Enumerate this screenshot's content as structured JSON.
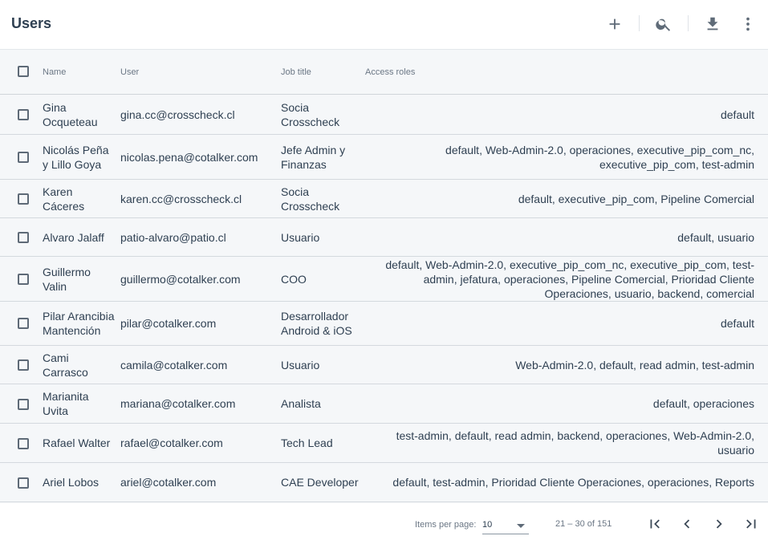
{
  "header": {
    "title": "Users",
    "actions": [
      {
        "icon": "add-icon"
      },
      {
        "icon": "search-icon"
      },
      {
        "icon": "download-icon"
      },
      {
        "icon": "more-vert-icon"
      }
    ]
  },
  "table": {
    "columns": [
      "Name",
      "User",
      "Job title",
      "Access roles"
    ],
    "rows": [
      {
        "name": "Gina Ocqueteau",
        "user": "gina.cc@crosscheck.cl",
        "job": "Socia Crosscheck",
        "roles": "default"
      },
      {
        "name": "Nicolás Peña y Lillo Goya",
        "user": "nicolas.pena@cotalker.com",
        "job": "Jefe Admin y Finanzas",
        "roles": "default, Web-Admin-2.0, operaciones, executive_pip_com_nc, executive_pip_com, test-admin"
      },
      {
        "name": "Karen Cáceres",
        "user": "karen.cc@crosscheck.cl",
        "job": "Socia Crosscheck",
        "roles": "default, executive_pip_com, Pipeline Comercial"
      },
      {
        "name": "Alvaro Jalaff",
        "user": "patio-alvaro@patio.cl",
        "job": "Usuario",
        "roles": "default, usuario"
      },
      {
        "name": "Guillermo Valin",
        "user": "guillermo@cotalker.com",
        "job": "COO",
        "roles": "default, Web-Admin-2.0, executive_pip_com_nc, executive_pip_com, test-admin, jefatura, operaciones, Pipeline Comercial, Prioridad Cliente Operaciones, usuario, backend, comercial"
      },
      {
        "name": "Pilar Arancibia Mantención",
        "user": "pilar@cotalker.com",
        "job": "Desarrollador Android & iOS",
        "roles": "default"
      },
      {
        "name": "Cami Carrasco",
        "user": "camila@cotalker.com",
        "job": "Usuario",
        "roles": "Web-Admin-2.0, default, read admin, test-admin"
      },
      {
        "name": "Marianita Uvita",
        "user": "mariana@cotalker.com",
        "job": "Analista",
        "roles": "default, operaciones"
      },
      {
        "name": "Rafael Walter",
        "user": "rafael@cotalker.com",
        "job": "Tech Lead",
        "roles": "test-admin, default, read admin, backend, operaciones, Web-Admin-2.0, usuario"
      },
      {
        "name": "Ariel Lobos",
        "user": "ariel@cotalker.com",
        "job": "CAE Developer",
        "roles": "default, test-admin, Prioridad Cliente Operaciones, operaciones, Reports"
      }
    ]
  },
  "footer": {
    "items_per_page_label": "Items per page:",
    "items_per_page_value": "10",
    "range_label": "21 – 30 of 151",
    "nav": [
      {
        "icon": "first-page-icon"
      },
      {
        "icon": "previous-page-icon"
      },
      {
        "icon": "next-page-icon"
      },
      {
        "icon": "last-page-icon"
      }
    ]
  },
  "colors": {
    "text": "#2f4052",
    "muted": "#6b7785",
    "table_bg": "#f5f7f9",
    "divider": "#d4d9de"
  }
}
